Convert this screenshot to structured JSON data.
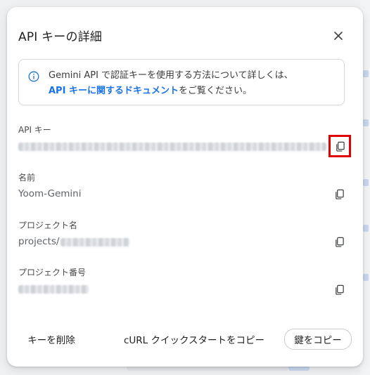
{
  "dialog": {
    "title": "API キーの詳細",
    "info": {
      "text_before": "Gemini API で認証キーを使用する方法について詳しくは、",
      "link": "API キーに関するドキュメント",
      "text_after": "をご覧ください。"
    },
    "fields": {
      "api_key_label": "API キー",
      "name_label": "名前",
      "name_value": "Yoom-Gemini",
      "project_name_label": "プロジェクト名",
      "project_name_prefix": "projects/",
      "project_number_label": "プロジェクト番号"
    },
    "footer": {
      "delete_label": "キーを削除",
      "curl_label": "cURL クイックスタートをコピー",
      "copy_key_label": "鍵をコピー"
    },
    "colors": {
      "link": "#1a73e8",
      "highlight": "#e00000"
    }
  }
}
